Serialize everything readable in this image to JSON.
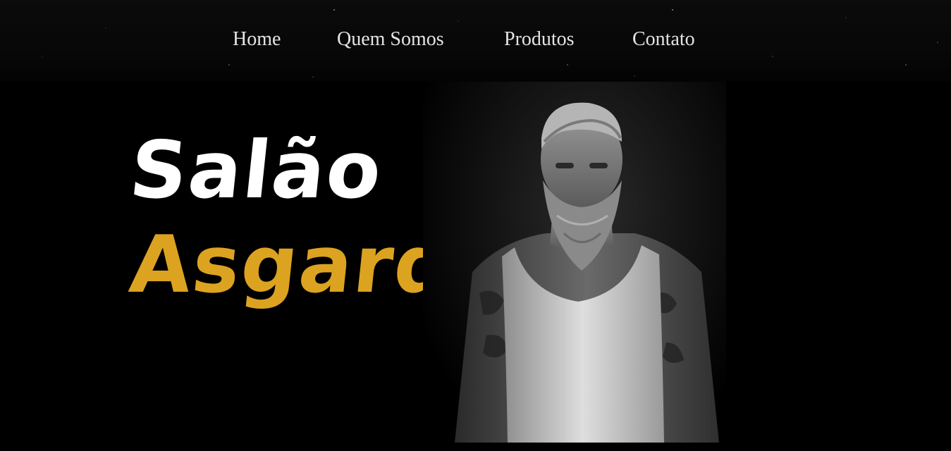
{
  "nav": {
    "items": [
      {
        "label": "Home"
      },
      {
        "label": "Quem Somos"
      },
      {
        "label": "Produtos"
      },
      {
        "label": "Contato"
      }
    ]
  },
  "hero": {
    "title_line1": "Salão",
    "title_line2": "Asgard",
    "image": {
      "icon": "bearded-man-photo",
      "description_colors": [
        "#000000",
        "#ffffff",
        "#dca321"
      ]
    }
  },
  "colors": {
    "background": "#000000",
    "nav_text": "#e4e4e4",
    "title_primary": "#ffffff",
    "title_accent": "#dca321"
  }
}
